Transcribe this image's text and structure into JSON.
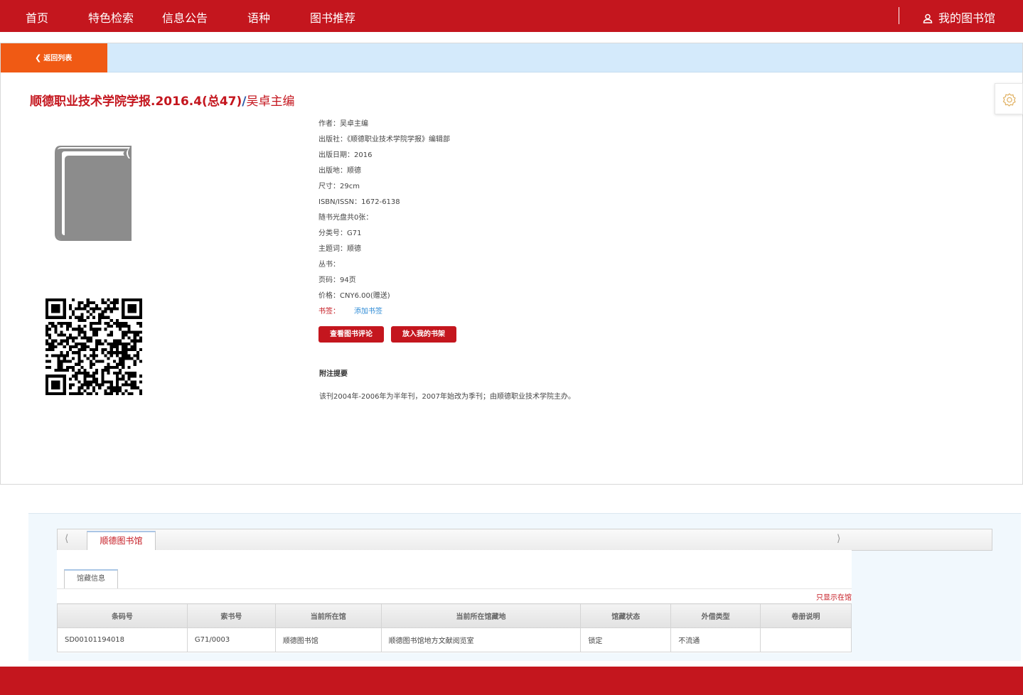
{
  "nav": {
    "items": [
      "首页",
      "特色检索",
      "信息公告",
      "语种",
      "图书推荐"
    ],
    "my_library": "我的图书馆",
    "my_library_icon": "user-icon"
  },
  "back_button": "返回列表",
  "book": {
    "title_main": "顺德职业技术学院学报.2016.4(总47)",
    "title_slash": "/",
    "title_author": "吴卓主编",
    "cover_icon": "book-icon",
    "qr_icon": "qr-code-icon"
  },
  "info": {
    "rows": [
      "作者：吴卓主编",
      "出版社：《顺德职业技术学院学报》编辑部",
      "出版日期：2016",
      "出版地：顺德",
      "尺寸：29cm",
      "ISBN/ISSN：1672-6138",
      "随书光盘共0张：",
      "分类号：G71",
      "主题词：顺德",
      "丛书：",
      "页码：94页",
      "价格：CNY6.00(赠送)"
    ],
    "tag_label": "书签：",
    "tag_add": "添加书签"
  },
  "buttons": {
    "reviews": "查看图书评论",
    "add_shelf": "放入我的书架"
  },
  "note": {
    "title": "附注提要",
    "body": "该刊2004年-2006年为半年刊，2007年始改为季刊；由顺德职业技术学院主办。"
  },
  "holdings": {
    "library_tab": "顺德图书馆",
    "sub_tab": "馆藏信息",
    "only_show": "只显示在馆",
    "columns": [
      "条码号",
      "索书号",
      "当前所在馆",
      "当前所在馆藏地",
      "馆藏状态",
      "外借类型",
      "卷册说明"
    ],
    "rows": [
      [
        "SD00101194018",
        "G71/0003",
        "顺德图书馆",
        "顺德图书馆地方文献阅览室",
        "锁定",
        "不流通",
        ""
      ]
    ]
  },
  "colors": {
    "brand_red": "#c4161e",
    "back_orange": "#f05a14",
    "back_bar_blue": "#d4eafb",
    "link_blue": "#2e8bd6"
  }
}
